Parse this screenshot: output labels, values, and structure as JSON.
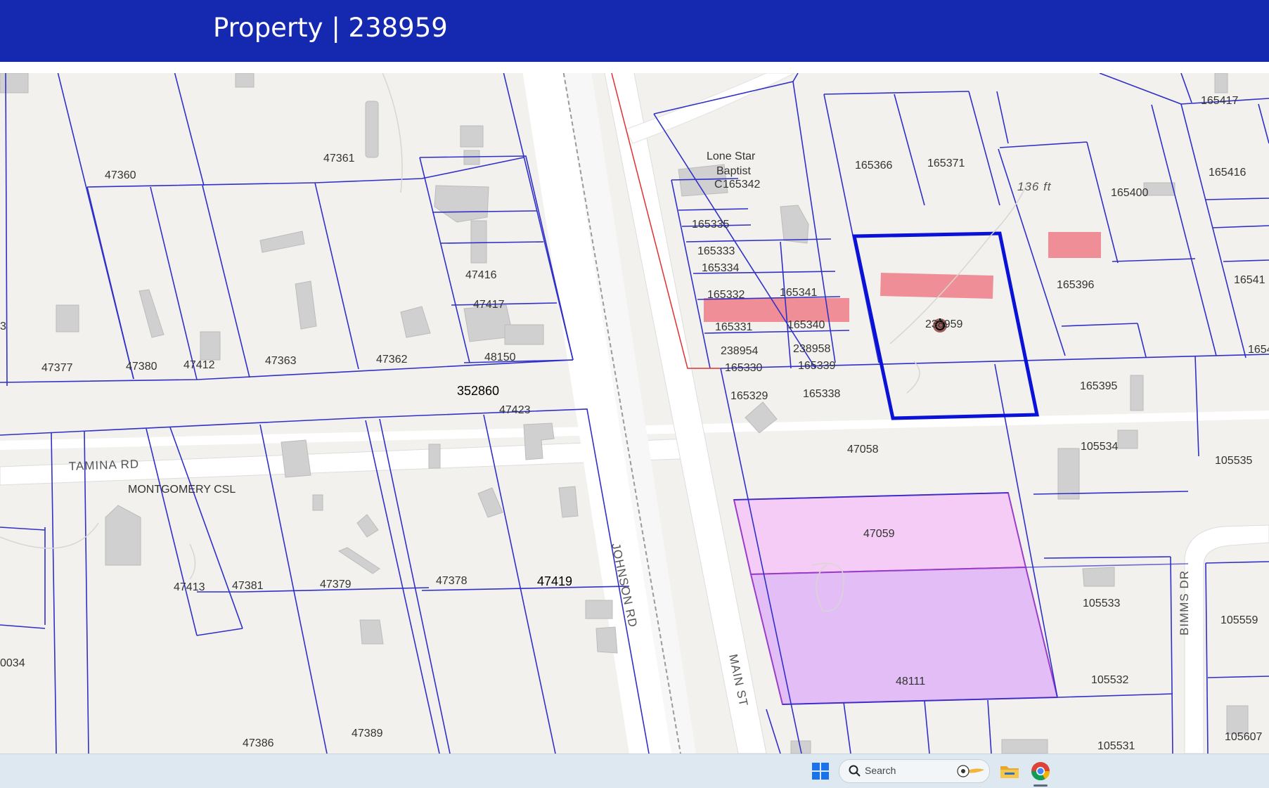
{
  "header": {
    "title": "Property | 238959"
  },
  "colors": {
    "header_bg": "#1428b0",
    "parcel_outline": "#3030c8",
    "selected_outline": "#0a12d8",
    "highlight_red": "#ee7c86",
    "highlight_pink": "#f4ccf6",
    "highlight_purple": "#e2bdf6",
    "map_bg": "#f2f1ee",
    "road": "#ffffff",
    "building": "#d0d0d0"
  },
  "map": {
    "selected_parcel": "238959",
    "parcels": {
      "p47360": "47360",
      "p47361": "47361",
      "p47377": "47377",
      "p47380": "47380",
      "p47412": "47412",
      "p47363": "47363",
      "p47362": "47362",
      "p47416": "47416",
      "p47417": "47417",
      "p48150": "48150",
      "p352860": "352860",
      "p47423": "47423",
      "p47413": "47413",
      "p47381": "47381",
      "p47379": "47379",
      "p47378": "47378",
      "p47419": "47419",
      "p47386": "47386",
      "p47389": "47389",
      "p0034": "0034",
      "p165342": "165342",
      "p165335": "165335",
      "p165333": "165333",
      "p165334": "165334",
      "p165332": "165332",
      "p165341": "165341",
      "p165331": "165331",
      "p165340": "165340",
      "p238954": "238954",
      "p238958": "238958",
      "p165330": "165330",
      "p165339": "165339",
      "p165329": "165329",
      "p165338": "165338",
      "p165366": "165366",
      "p165371": "165371",
      "p238959": "238959",
      "p165400": "165400",
      "p165396": "165396",
      "p165395": "165395",
      "p165417": "165417",
      "p165416": "165416",
      "p165415": "16541",
      "p1654": "1654",
      "p47058": "47058",
      "p47059": "47059",
      "p48111": "48111",
      "p105534": "105534",
      "p105535": "105535",
      "p105533": "105533",
      "p105559": "105559",
      "p105532": "105532",
      "p105531": "105531",
      "p105607": "105607",
      "p3": "3"
    },
    "church_line1": "Lone Star",
    "church_line2": "Baptist",
    "church_line3": "C",
    "measurement": "136 ft",
    "roads": {
      "tamina": "TAMINA RD",
      "montgomery": "MONTGOMERY CSL",
      "johnson": "JOHNSON RD",
      "main": "MAIN ST",
      "bimms": "BIMMS DR"
    }
  },
  "taskbar": {
    "search_label": "Search",
    "icons": [
      "windows-start-icon",
      "search-icon",
      "file-explorer-icon",
      "chrome-icon"
    ]
  }
}
